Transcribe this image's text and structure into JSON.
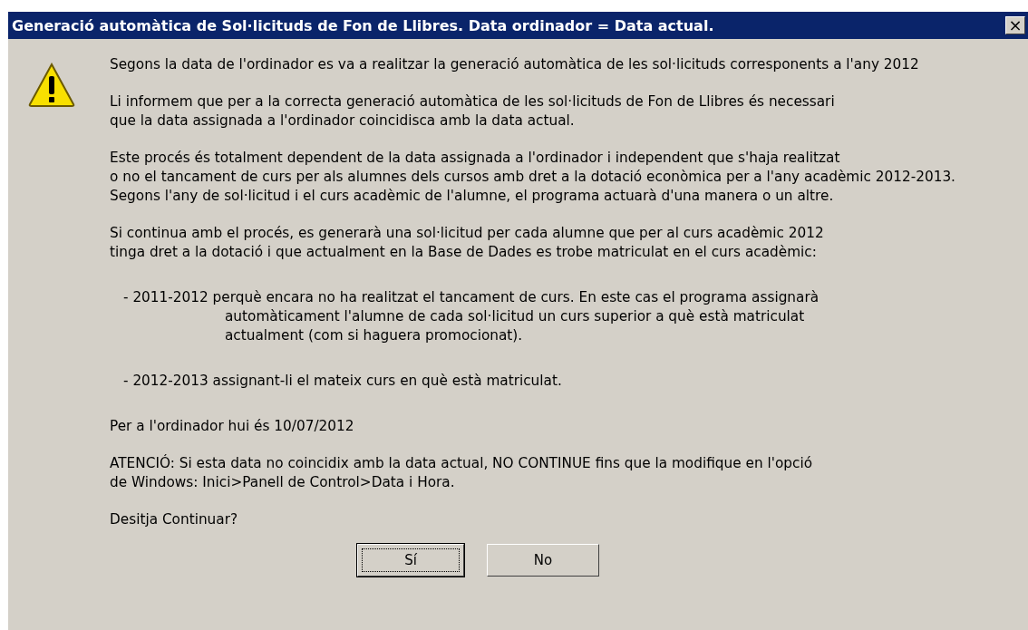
{
  "window": {
    "title": "Generació automàtica de Sol·licituds de Fon de Llibres. Data ordinador = Data actual."
  },
  "message": {
    "blocks": [
      {
        "kind": "paragraph",
        "lines": [
          "Segons la data de l'ordinador es va a realitzar la generació automàtica de les sol·licituds corresponents a l'any 2012"
        ]
      },
      {
        "kind": "paragraph",
        "lines": [
          "Li informem que per a la correcta generació automàtica de les sol·licituds de Fon de Llibres és necessari",
          "que la data assignada a l'ordinador coincidisca amb la data actual."
        ]
      },
      {
        "kind": "paragraph",
        "lines": [
          "Este procés és totalment dependent de la data assignada a l'ordinador i independent que s'haja realitzat",
          "o no el tancament de curs per als alumnes dels cursos amb dret a la dotació econòmica per a l'any acadèmic 2012-2013.",
          "Segons l'any de sol·licitud i el curs acadèmic de l'alumne, el programa actuarà d'una manera o un altre."
        ]
      },
      {
        "kind": "paragraph",
        "lines": [
          "Si continua amb el procés, es generarà una sol·licitud per cada alumne que per al curs acadèmic 2012",
          "tinga dret a la dotació i que actualment en la Base de Dades es trobe matriculat en el curs acadèmic:"
        ]
      },
      {
        "kind": "bullet",
        "lines": [
          "- 2011-2012 perquè encara no ha realitzat el tancament de curs. En este cas el programa assignarà",
          "automàticament l'alumne de cada sol·licitud un curs superior a què està matriculat",
          "actualment (com si haguera promocionat)."
        ]
      },
      {
        "kind": "bullet",
        "lines": [
          "- 2012-2013 assignant-li el mateix curs en què està matriculat."
        ]
      },
      {
        "kind": "paragraph",
        "lines": [
          "Per a l'ordinador hui és 10/07/2012"
        ]
      },
      {
        "kind": "paragraph",
        "lines": [
          "ATENCIÓ: Si esta data no coincidix amb la data actual, NO CONTINUE fins que la modifique en l'opció",
          "de Windows: Inici>Panell de Control>Data i Hora."
        ]
      },
      {
        "kind": "paragraph",
        "lines": [
          "Desitja Continuar?"
        ]
      }
    ]
  },
  "close_button": {
    "label": "×"
  },
  "buttons": [
    {
      "label": "Sí",
      "focused": true
    },
    {
      "label": "No",
      "focused": false
    }
  ]
}
